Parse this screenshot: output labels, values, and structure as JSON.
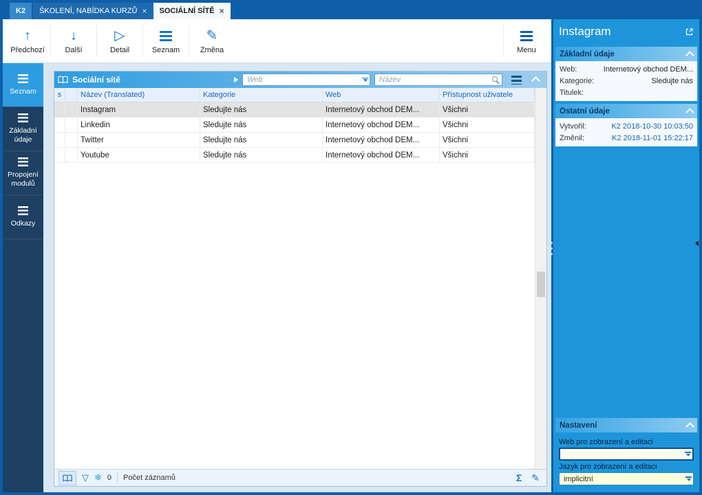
{
  "tabbar": {
    "app_tab": "K2",
    "close_glyph": "×",
    "tabs": [
      {
        "label": "ŠKOLENÍ, NABÍDKA KURZŮ"
      },
      {
        "label": "SOCIÁLNÍ SÍTĚ"
      }
    ]
  },
  "toolbar": {
    "buttons": [
      {
        "label": "Předchozí",
        "glyph": "↑"
      },
      {
        "label": "Další",
        "glyph": "↓"
      },
      {
        "label": "Detail",
        "glyph": "▷"
      },
      {
        "label": "Seznam"
      },
      {
        "label": "Změna",
        "glyph": "✎"
      }
    ],
    "menu_label": "Menu"
  },
  "sidebar": {
    "items": [
      {
        "label": "Seznam"
      },
      {
        "label": "Základní údaje"
      },
      {
        "label": "Propojení modulů"
      },
      {
        "label": "Odkazy"
      }
    ]
  },
  "browse": {
    "title": "Sociální sítě",
    "filter_web_placeholder": "Web",
    "filter_name_placeholder": "Název",
    "columns": [
      "s",
      "",
      "Název (Translated)",
      "Kategorie",
      "Web",
      "Přístupnost uživatele"
    ],
    "rows": [
      {
        "name": "Instagram",
        "category": "Sledujte nás",
        "web": "Internetový obchod DEM...",
        "access": "Všichni"
      },
      {
        "name": "Linkedin",
        "category": "Sledujte nás",
        "web": "Internetový obchod DEM...",
        "access": "Všichni"
      },
      {
        "name": "Twitter",
        "category": "Sledujte nás",
        "web": "Internetový obchod DEM...",
        "access": "Všichni"
      },
      {
        "name": "Youtube",
        "category": "Sledujte nás",
        "web": "Internetový obchod DEM...",
        "access": "Všichni"
      }
    ]
  },
  "statusbar": {
    "funnel_glyph": "▽",
    "snowflake_glyph": "❄",
    "flag_count": "0",
    "records_label": "Počet záznamů",
    "sigma_glyph": "Σ",
    "pencil_glyph": "✎"
  },
  "preview": {
    "title": "Instagram",
    "basic": {
      "title": "Základní údaje",
      "fields": [
        {
          "label": "Web:",
          "value": "Internetový obchod DEM..."
        },
        {
          "label": "Kategorie:",
          "value": "Sledujte nás"
        },
        {
          "label": "Titulek:",
          "value": ""
        }
      ]
    },
    "other": {
      "title": "Ostatní údaje",
      "fields": [
        {
          "label": "Vytvořil:",
          "value": "K2 2018-10-30 10:03:50"
        },
        {
          "label": "Změnil:",
          "value": "K2 2018-11-01 15:22:17"
        }
      ]
    },
    "settings": {
      "title": "Nastavení",
      "web_label": "Web pro zobrazení a editaci",
      "web_value": "",
      "lang_label": "Jazyk pro zobrazení a editaci",
      "lang_value": "implicitní"
    }
  },
  "colors": {
    "frame_blue": "#0e5fa8",
    "panel_blue": "#1e95db",
    "accent_blue": "#1a74c4",
    "sidebar_navy": "#1d4063",
    "sidebar_active": "#2e9ce0",
    "selected_row": "#e3e3e3"
  }
}
